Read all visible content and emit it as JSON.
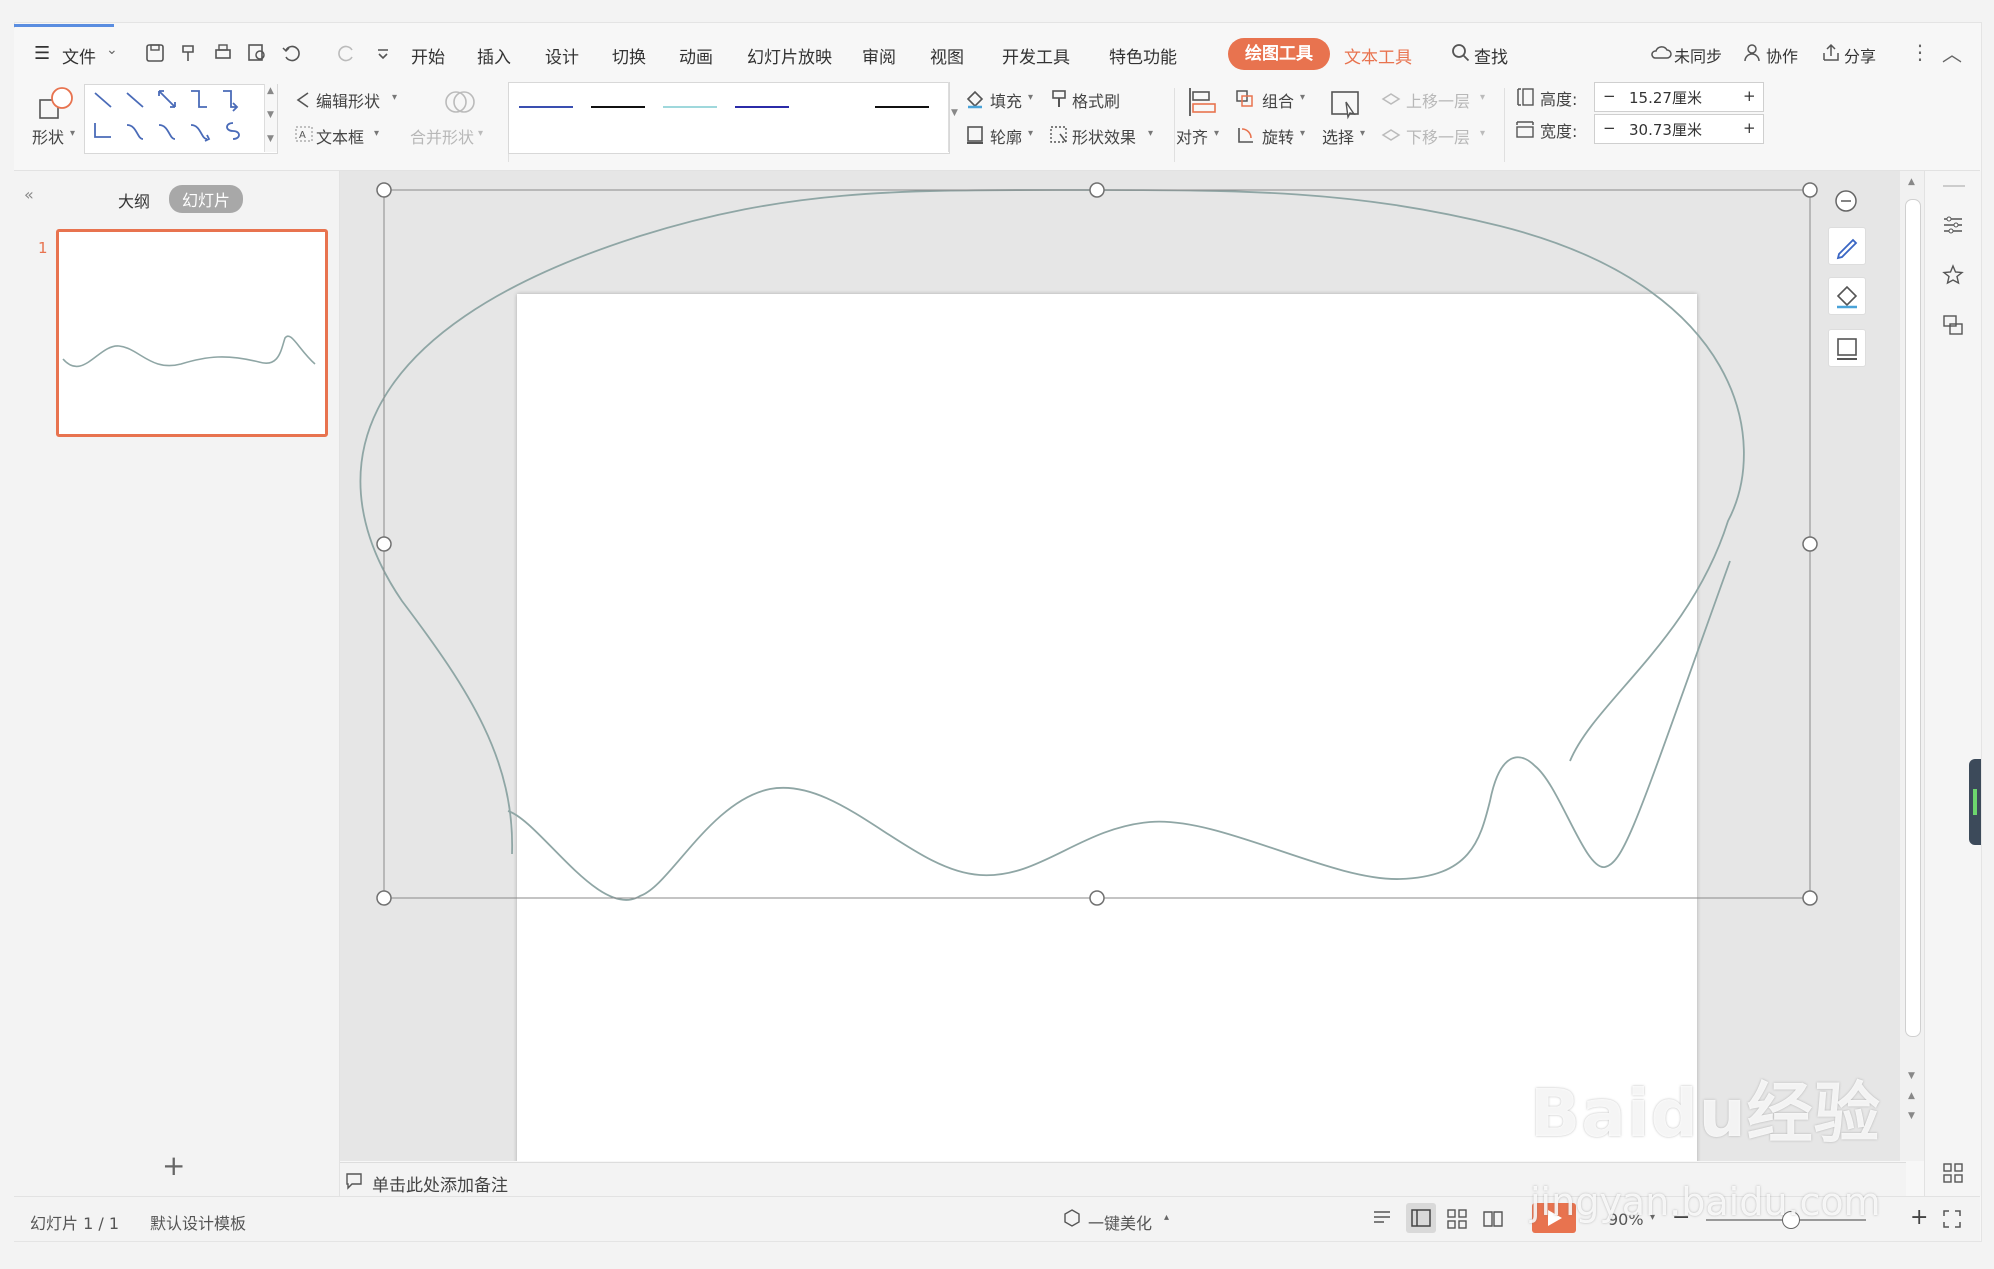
{
  "menu": {
    "file_label": "文件",
    "tabs": [
      "开始",
      "插入",
      "设计",
      "切换",
      "动画",
      "幻灯片放映",
      "审阅",
      "视图",
      "开发工具",
      "特色功能"
    ],
    "drawing_tools": "绘图工具",
    "text_tools": "文本工具",
    "search": "查找",
    "sync": "未同步",
    "collab": "协作",
    "share": "分享"
  },
  "ribbon": {
    "shapes": "形状",
    "edit_shape": "编辑形状",
    "textbox": "文本框",
    "merge_shape": "合并形状",
    "fill": "填充",
    "format_painter": "格式刷",
    "outline": "轮廓",
    "shape_effect": "形状效果",
    "align": "对齐",
    "group": "组合",
    "rotate": "旋转",
    "select": "选择",
    "bring_forward": "上移一层",
    "send_backward": "下移一层",
    "height_label": "高度:",
    "height_value": "15.27厘米",
    "width_label": "宽度:",
    "width_value": "30.73厘米",
    "minus": "−",
    "plus": "+"
  },
  "panel": {
    "outline_tab": "大纲",
    "slides_tab": "幻灯片",
    "slide_number": "1",
    "add": "+"
  },
  "notes": {
    "placeholder": "单击此处添加备注"
  },
  "status": {
    "slide_info": "幻灯片 1 / 1",
    "template": "默认设计模板",
    "beautify": "一键美化",
    "zoom": "90%"
  },
  "watermark": {
    "brand": "Baidu经验",
    "url": "jingyan.baidu.com"
  },
  "colors": {
    "accent": "#e8734f",
    "curve": "#8fa6a5"
  }
}
